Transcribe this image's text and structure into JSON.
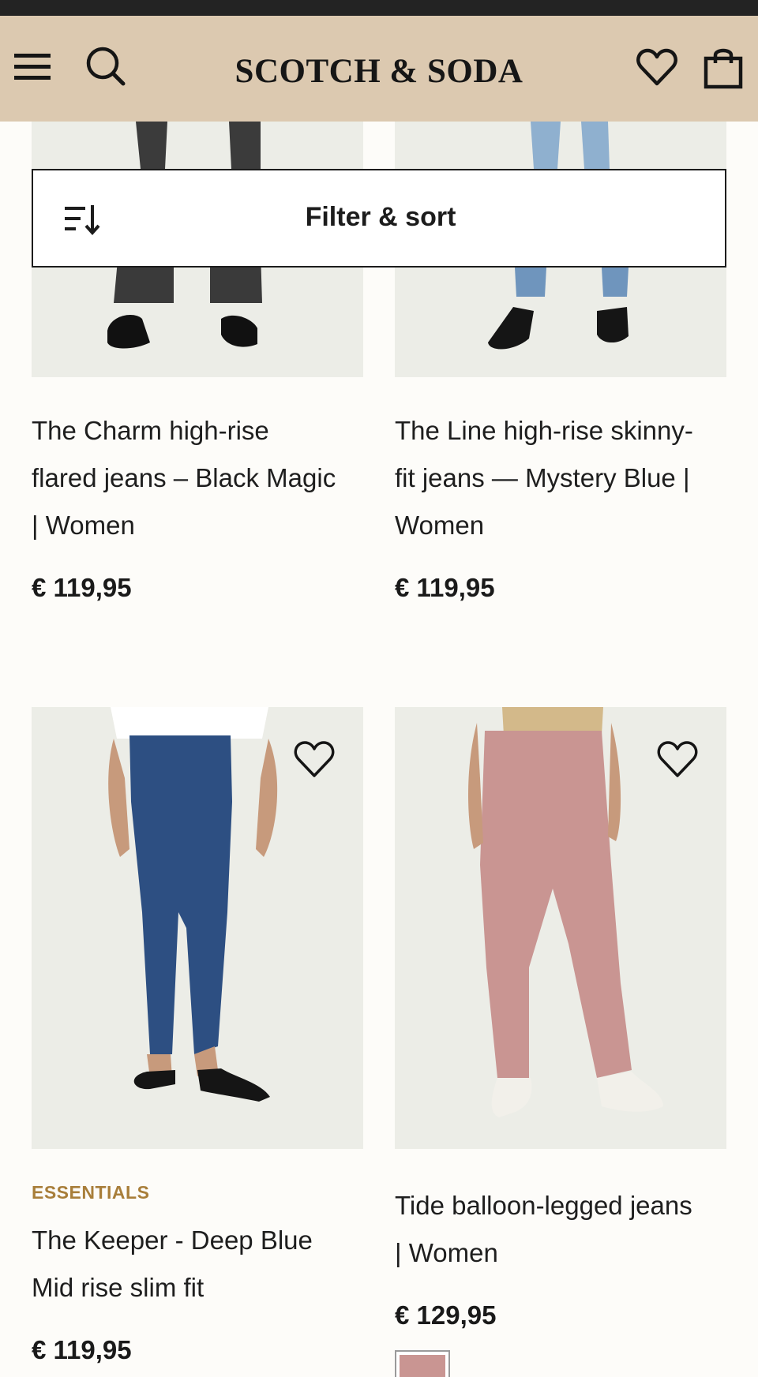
{
  "header": {
    "brand": "SCOTCH & SODA",
    "icons": [
      "menu-icon",
      "search-icon",
      "heart-icon",
      "shopping-bag-icon"
    ],
    "background": "#dcc9b0"
  },
  "filter": {
    "label": "Filter & sort",
    "icon": "sort-icon"
  },
  "products": [
    {
      "title_lines": [
        "The Charm high-rise",
        "flared jeans – Black Magic",
        "| Women"
      ],
      "price": "€ 119,95"
    },
    {
      "title_lines": [
        "The Line high-rise skinny-",
        "fit jeans — Mystery Blue |",
        "Women"
      ],
      "price": "€ 119,95"
    },
    {
      "tag": "ESSENTIALS",
      "title_lines": [
        "The Keeper - Deep Blue",
        "Mid rise slim fit"
      ],
      "price": "€ 119,95"
    },
    {
      "title_lines": [
        "Tide balloon-legged jeans",
        "| Women"
      ],
      "price": "€ 129,95",
      "swatch_color": "#c99592"
    }
  ],
  "colors": {
    "accent_tag": "#a87e3a",
    "image_bg": "#ecede7",
    "page_bg": "#fdfcf9"
  }
}
